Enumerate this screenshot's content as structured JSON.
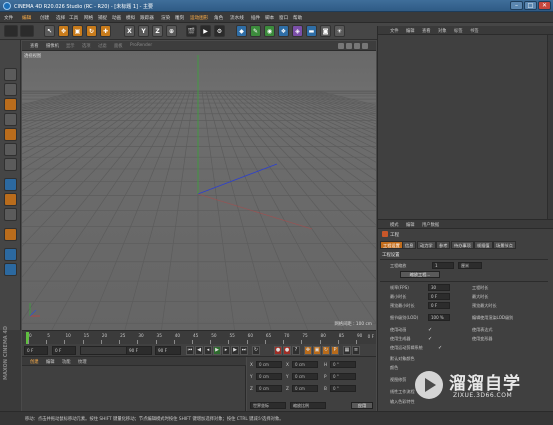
{
  "window": {
    "title": "CINEMA 4D R20.026 Studio (RC - R20) - [未标题 1] - 主要",
    "minimize": "–",
    "maximize": "□",
    "close": "✕"
  },
  "menubar": {
    "items": [
      "文件",
      "编辑",
      "创建",
      "选择",
      "工具",
      "网格",
      "捕捉",
      "动画",
      "模拟",
      "跟踪器",
      "渲染",
      "雕刻",
      "运动图形",
      "角色",
      "流水线",
      "插件",
      "脚本",
      "窗口",
      "帮助"
    ]
  },
  "toolbar": {
    "axis_x": "X",
    "axis_y": "Y",
    "axis_z": "Z"
  },
  "layout": {
    "label": "界面",
    "value": "启动"
  },
  "viewport": {
    "menus": [
      "查看",
      "摄像机",
      "显示",
      "选项",
      "过滤",
      "面板",
      "ProRender"
    ],
    "label": "透视视图",
    "grid_label": "网格间距 : 100 cm"
  },
  "timeline": {
    "ticks": [
      "0",
      "5",
      "10",
      "15",
      "20",
      "25",
      "30",
      "35",
      "40",
      "45",
      "50",
      "55",
      "60",
      "65",
      "70",
      "75",
      "80",
      "85",
      "90"
    ],
    "frame_end": "0 F"
  },
  "transport": {
    "start_field": "0 F",
    "current_field": "0 F",
    "end_field": "90 F",
    "end_field2": "90 F"
  },
  "materials": {
    "tabs": [
      "创建",
      "编辑",
      "功能",
      "纹理"
    ]
  },
  "coords": {
    "rows": [
      {
        "a": "X",
        "av": "0 cm",
        "b": "X",
        "bv": "0 cm",
        "c": "H",
        "cv": "0 °"
      },
      {
        "a": "Y",
        "av": "0 cm",
        "b": "Y",
        "bv": "0 cm",
        "c": "P",
        "cv": "0 °"
      },
      {
        "a": "Z",
        "av": "0 cm",
        "b": "Z",
        "bv": "0 cm",
        "c": "B",
        "cv": "0 °"
      }
    ],
    "mode1": "世界坐标",
    "mode2": "缩放比例",
    "apply": "应用"
  },
  "object_manager": {
    "menus": [
      "文件",
      "编辑",
      "查看",
      "对象",
      "标签",
      "书签"
    ]
  },
  "attribute_manager": {
    "menus": [
      "模式",
      "编辑",
      "用户数据"
    ],
    "title": "工程",
    "tabs": [
      "工程设置",
      "信息",
      "动力学",
      "参考",
      "待办事项",
      "帧插值",
      "场景节点"
    ],
    "section_project": "工程设置",
    "scale_label": "工程缩放",
    "scale_value": "1",
    "scale_unit": "厘米",
    "scale_button": "缩放工程...",
    "fps_label": "帧率(FPS)",
    "fps_value": "30",
    "time_label": "工程时长",
    "time_value": "0 F",
    "min_time_label": "最小时长",
    "min_time_value": "0 F",
    "max_time_label": "最大时长",
    "max_time_value": "90 F",
    "preview_min_label": "预览最小时长",
    "preview_min_value": "0 F",
    "preview_max_label": "预览最大时长",
    "preview_max_value": "90 F",
    "lod_label": "细节级别(LOD)",
    "lod_value": "100 %",
    "lod_render_label": "编辑使用渲染LOD级别",
    "use_anim_label": "使用动画",
    "use_expr_label": "使用表达式",
    "use_gen_label": "使用生成器",
    "use_deform_label": "使用变形器",
    "use_motion_label": "使用运动剪辑系统",
    "default_obj_color_label": "默认对象颜色",
    "color_label": "颜色",
    "view_clip_label": "视图修剪",
    "linear_flow_label": "线性工作流程",
    "input_color_label": "输入色彩特性",
    "check": "✓"
  },
  "status": {
    "text": "移动：点击并拖动鼠标移动元素。按住 SHIFT 键量化移动；节点编辑模式时按住 SHIFT 键增加选择对象；按住 CTRL 键减少选择对象。"
  },
  "watermark": {
    "title": "溜溜自学",
    "url": "ZIXUE.3D66.COM"
  },
  "side": {
    "brand": "MAXON CINEMA 4D"
  }
}
